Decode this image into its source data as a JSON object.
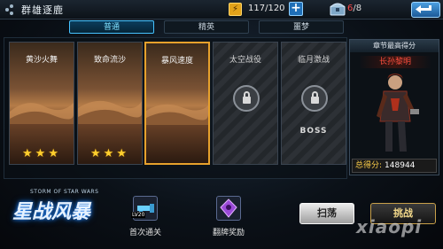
{
  "topbar": {
    "title": "群雄逐鹿",
    "energy_icon": "lightning-icon",
    "energy": "117/120",
    "plus_label": "+",
    "chest_icon": "treasure-chest-icon",
    "chest_current": "6",
    "chest_sep_total": "/8",
    "back_icon": "back-arrow-icon"
  },
  "tabs": [
    {
      "label": "普通",
      "active": true
    },
    {
      "label": "精英",
      "active": false
    },
    {
      "label": "噩梦",
      "active": false
    }
  ],
  "stages": [
    {
      "name": "黄沙火舞",
      "stars": "★★★",
      "locked": false,
      "selected": false
    },
    {
      "name": "致命流沙",
      "stars": "★★★",
      "locked": false,
      "selected": false
    },
    {
      "name": "暴风速度",
      "stars": "",
      "locked": false,
      "selected": true
    },
    {
      "name": "太空战役",
      "locked": true
    },
    {
      "name": "临月激战",
      "locked": true,
      "boss_label": "BOSS"
    }
  ],
  "hero_panel": {
    "header": "章节最高得分",
    "hero_name": "长孙黎明",
    "score_label": "总得分:",
    "score_value": "148944"
  },
  "logo": {
    "english": "STORM OF STAR WARS",
    "chinese": "星战风暴"
  },
  "rewards": [
    {
      "label": "首次通关",
      "icon": "blaster-gun-icon",
      "level": "LV20"
    },
    {
      "label": "翻牌奖励",
      "icon": "purple-gem-icon"
    }
  ],
  "buttons": {
    "sweep": "扫荡",
    "challenge": "挑战"
  },
  "watermark": "xiaopi",
  "colors": {
    "selected_border": "#e7a12c",
    "star": "#ffcf2e",
    "hero_name": "#ff4f3e",
    "tab_active": "#46c2ff"
  }
}
